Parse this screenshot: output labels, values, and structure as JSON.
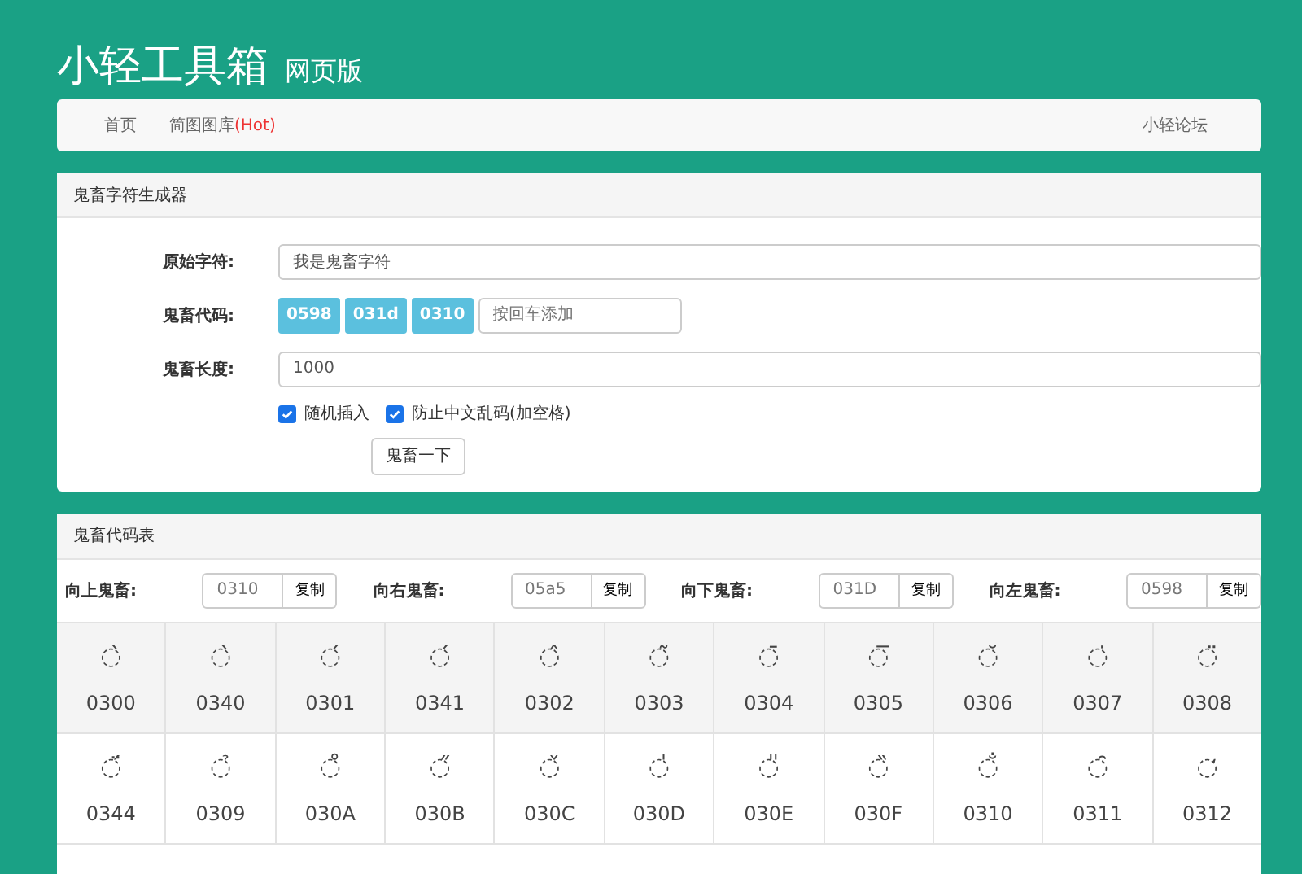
{
  "header": {
    "title": "小轻工具箱",
    "subtitle": "网页版"
  },
  "nav": {
    "items": [
      {
        "label": "首页"
      },
      {
        "label": "简图图库",
        "badge": "(Hot)"
      }
    ],
    "right": "小轻论坛"
  },
  "generator": {
    "title": "鬼畜字符生成器",
    "fields": [
      {
        "label": "原始字符:",
        "kind": "text",
        "value": "我是鬼畜字符"
      },
      {
        "label": "鬼畜代码:",
        "kind": "tags",
        "tags": [
          "0598",
          "031d",
          "0310"
        ],
        "placeholder": "按回车添加"
      },
      {
        "label": "鬼畜长度:",
        "kind": "text",
        "value": "1000"
      }
    ],
    "options": [
      {
        "label": "随机插入",
        "checked": true
      },
      {
        "label": "防止中文乱码(加空格)",
        "checked": true
      }
    ],
    "button": "鬼畜一下"
  },
  "table": {
    "title": "鬼畜代码表",
    "directions": [
      {
        "label": "向上鬼畜:",
        "value": "0310",
        "button": "复制"
      },
      {
        "label": "向右鬼畜:",
        "value": "05a5",
        "button": "复制"
      },
      {
        "label": "向下鬼畜:",
        "value": "031D",
        "button": "复制"
      },
      {
        "label": "向左鬼畜:",
        "value": "0598",
        "button": "复制"
      }
    ],
    "rows": [
      [
        {
          "glyph": "◌̀",
          "code": "0300"
        },
        {
          "glyph": "◌̀",
          "code": "0340"
        },
        {
          "glyph": "◌́",
          "code": "0301"
        },
        {
          "glyph": "◌́",
          "code": "0341"
        },
        {
          "glyph": "◌̂",
          "code": "0302"
        },
        {
          "glyph": "◌̃",
          "code": "0303"
        },
        {
          "glyph": "◌̄",
          "code": "0304"
        },
        {
          "glyph": "◌̅",
          "code": "0305"
        },
        {
          "glyph": "◌̆",
          "code": "0306"
        },
        {
          "glyph": "◌̇",
          "code": "0307"
        },
        {
          "glyph": "◌̈",
          "code": "0308"
        }
      ],
      [
        {
          "glyph": "◌̈́",
          "code": "0344"
        },
        {
          "glyph": "◌̉",
          "code": "0309"
        },
        {
          "glyph": "◌̊",
          "code": "030A"
        },
        {
          "glyph": "◌̋",
          "code": "030B"
        },
        {
          "glyph": "◌̌",
          "code": "030C"
        },
        {
          "glyph": "◌̍",
          "code": "030D"
        },
        {
          "glyph": "◌̎",
          "code": "030E"
        },
        {
          "glyph": "◌̏",
          "code": "030F"
        },
        {
          "glyph": "◌̐",
          "code": "0310"
        },
        {
          "glyph": "◌̑",
          "code": "0311"
        },
        {
          "glyph": "◌̒",
          "code": "0312"
        }
      ]
    ]
  }
}
